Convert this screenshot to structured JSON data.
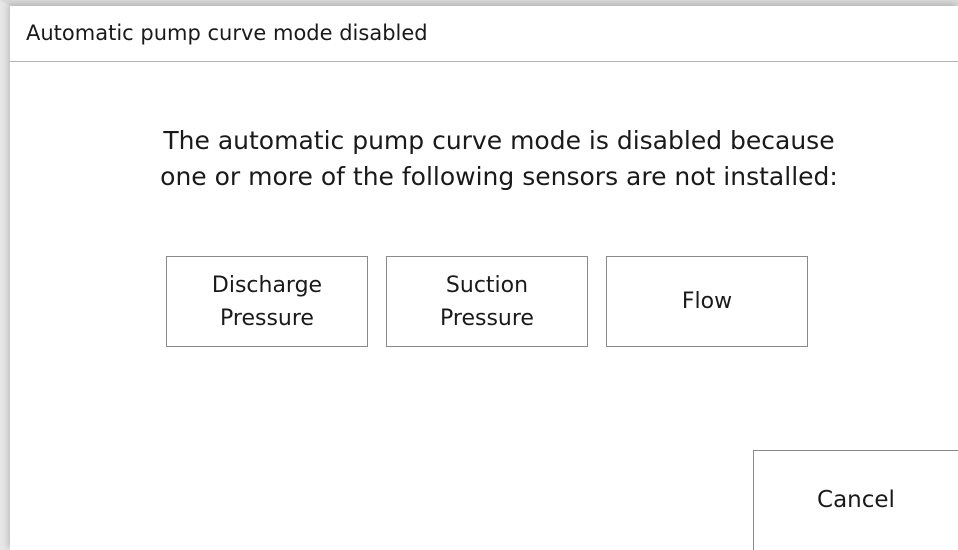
{
  "dialog": {
    "title": "Automatic pump curve mode disabled",
    "message": {
      "line1": "The automatic pump curve mode is disabled because",
      "line2": "one or more of the following sensors are not installed:"
    },
    "sensors": [
      {
        "line1": "Discharge",
        "line2": "Pressure"
      },
      {
        "line1": "Suction",
        "line2": "Pressure"
      },
      {
        "line1": "Flow"
      }
    ],
    "cancel_label": "Cancel"
  }
}
